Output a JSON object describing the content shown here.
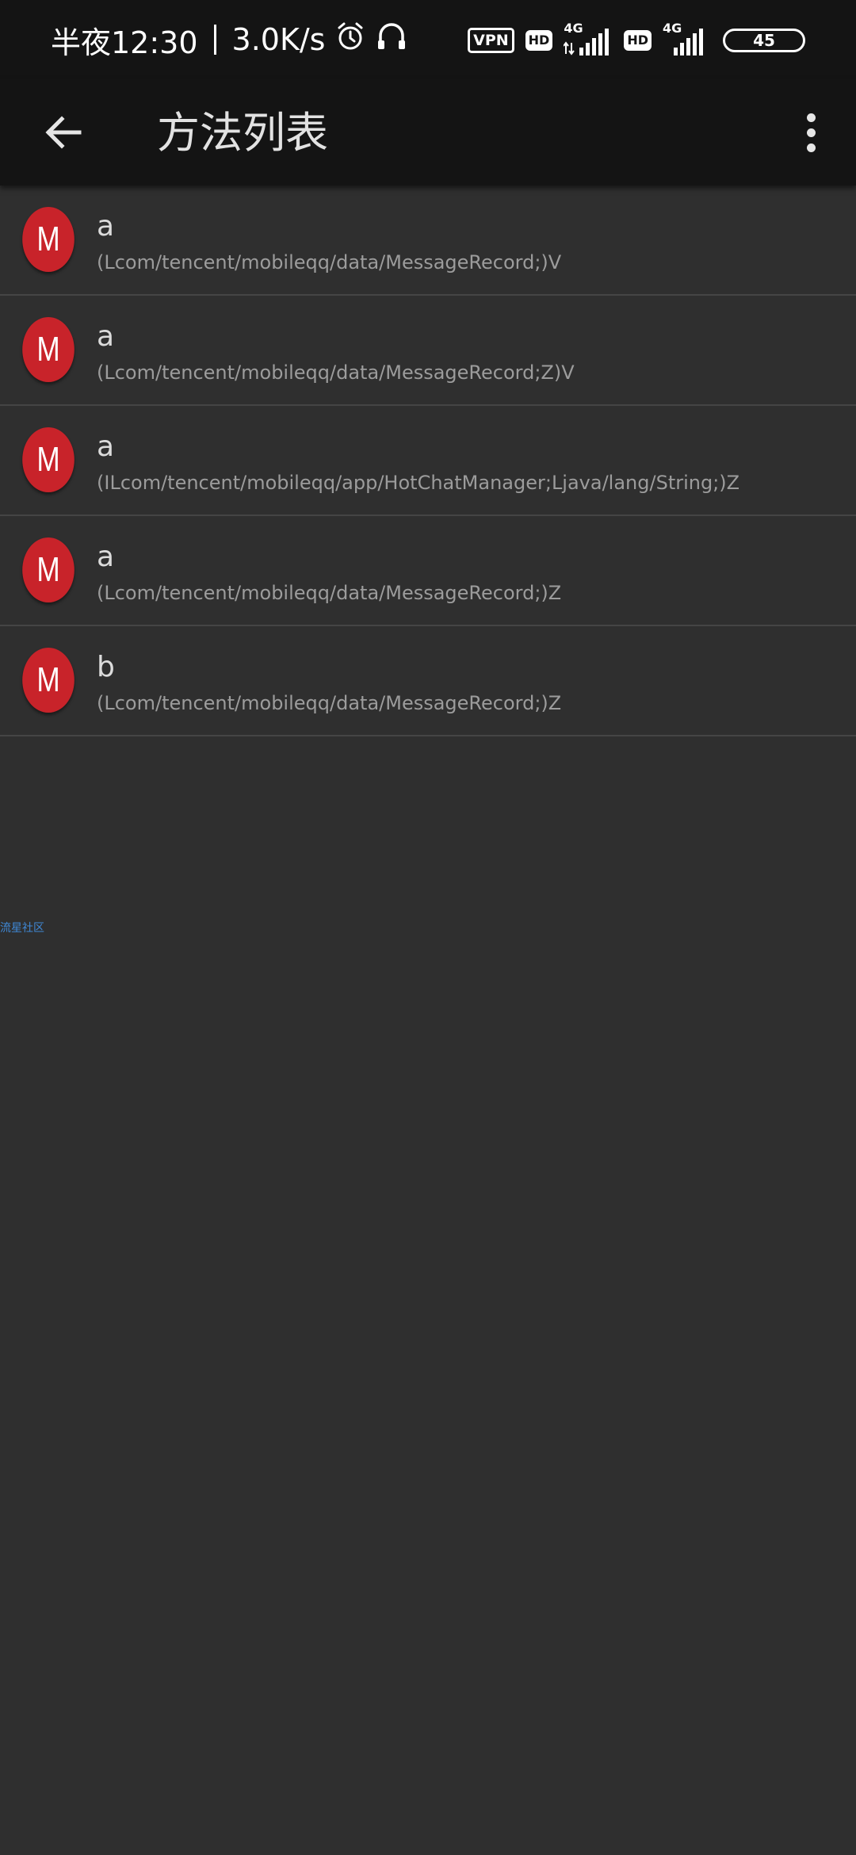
{
  "status_bar": {
    "time": "半夜12:30",
    "net_speed": "3.0K/s",
    "vpn": "VPN",
    "hd1": "HD",
    "net1": "4G",
    "hd2": "HD",
    "net2": "4G",
    "battery": "45",
    "icons": [
      "alarm-icon",
      "headset-icon"
    ]
  },
  "toolbar": {
    "back_icon": "arrow-left-icon",
    "title": "方法列表",
    "more_icon": "more-vert-icon"
  },
  "methods": [
    {
      "avatar": "M",
      "name": "a",
      "signature": "(Lcom/tencent/mobileqq/data/MessageRecord;)V"
    },
    {
      "avatar": "M",
      "name": "a",
      "signature": "(Lcom/tencent/mobileqq/data/MessageRecord;Z)V"
    },
    {
      "avatar": "M",
      "name": "a",
      "signature": "(ILcom/tencent/mobileqq/app/HotChatManager;Ljava/lang/String;)Z"
    },
    {
      "avatar": "M",
      "name": "a",
      "signature": "(Lcom/tencent/mobileqq/data/MessageRecord;)Z"
    },
    {
      "avatar": "M",
      "name": "b",
      "signature": "(Lcom/tencent/mobileqq/data/MessageRecord;)Z"
    }
  ],
  "watermark": "流星社区",
  "colors": {
    "background": "#2f2f2f",
    "toolbar": "#141414",
    "avatar": "#c8232a",
    "divider": "#454545",
    "watermark": "#3f88d6"
  }
}
